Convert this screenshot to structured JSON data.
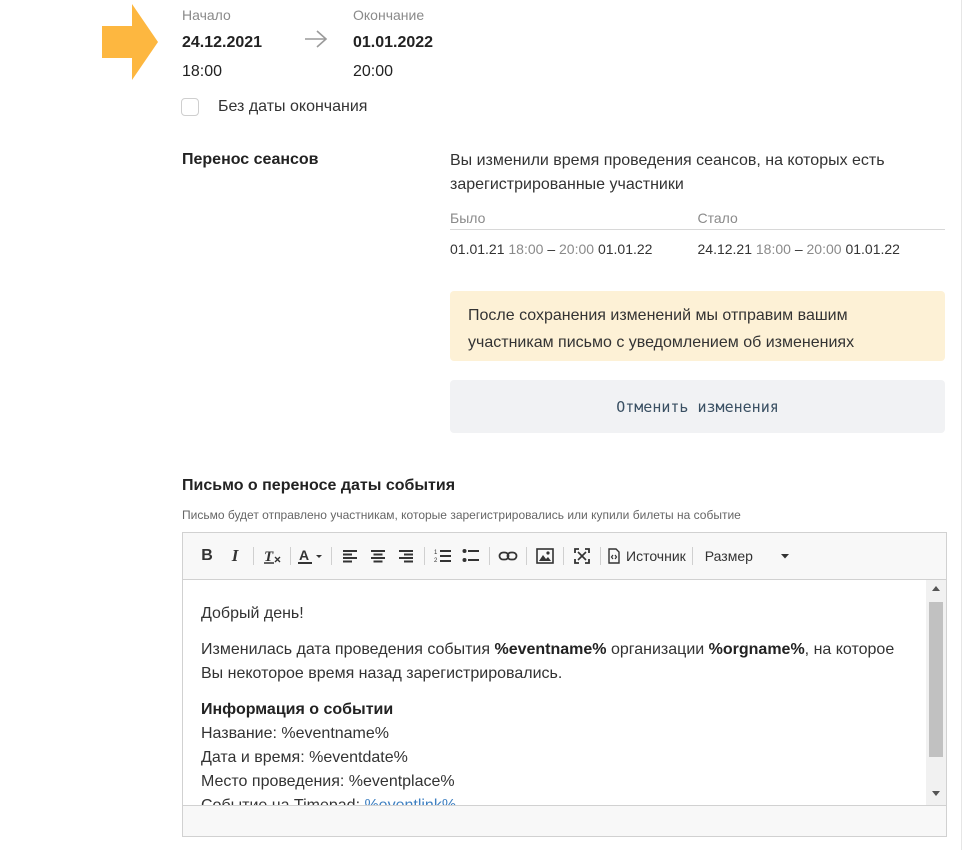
{
  "dates": {
    "start_label": "Начало",
    "start_date": "24.12.2021",
    "start_time": "18:00",
    "end_label": "Окончание",
    "end_date": "01.01.2022",
    "end_time": "20:00"
  },
  "no_end_date": {
    "label": "Без даты окончания",
    "checked": false
  },
  "reschedule": {
    "title": "Перенос сеансов",
    "description": "Вы изменили время проведения сеансов, на которых есть зарегистрированные участники",
    "col_before": "Было",
    "col_after": "Стало",
    "before": {
      "date_start": "01.01.21",
      "time_start": "18:00",
      "dash": "–",
      "time_end": "20:00",
      "date_end": "01.01.22"
    },
    "after": {
      "date_start": "24.12.21",
      "time_start": "18:00",
      "dash": "–",
      "time_end": "20:00",
      "date_end": "01.01.22"
    },
    "notice": "После сохранения изменений мы отправим вашим участникам письмо с уведомлением об изменениях",
    "cancel_label": "Отменить изменения"
  },
  "letter": {
    "title": "Письмо о переносе даты события",
    "hint": "Письмо будет отправлено участникам, которые зарегистрировались или купили билеты на событие",
    "toolbar": {
      "bold": "B",
      "italic": "I",
      "remove_format": "T",
      "text_color": "A",
      "source_label": "Источник",
      "size_label": "Размер"
    },
    "body": {
      "greeting": "Добрый день!",
      "p1_a": "Изменилась дата проведения события ",
      "p1_eventname": "%eventname%",
      "p1_b": " организации ",
      "p1_orgname": "%orgname%",
      "p1_c": ", на которое Вы некоторое время назад зарегистрировались.",
      "info_title": "Информация о событии",
      "name_line": "Название: %eventname%",
      "date_line": "Дата и время: %eventdate%",
      "place_line": "Место проведения: %eventplace%",
      "link_prefix": "Событие на Timepad: ",
      "link_text": "%eventlink%"
    }
  },
  "colors": {
    "accent_arrow": "#FDB740",
    "notice_bg": "#fdf1d6",
    "link": "#3d7fc1"
  }
}
